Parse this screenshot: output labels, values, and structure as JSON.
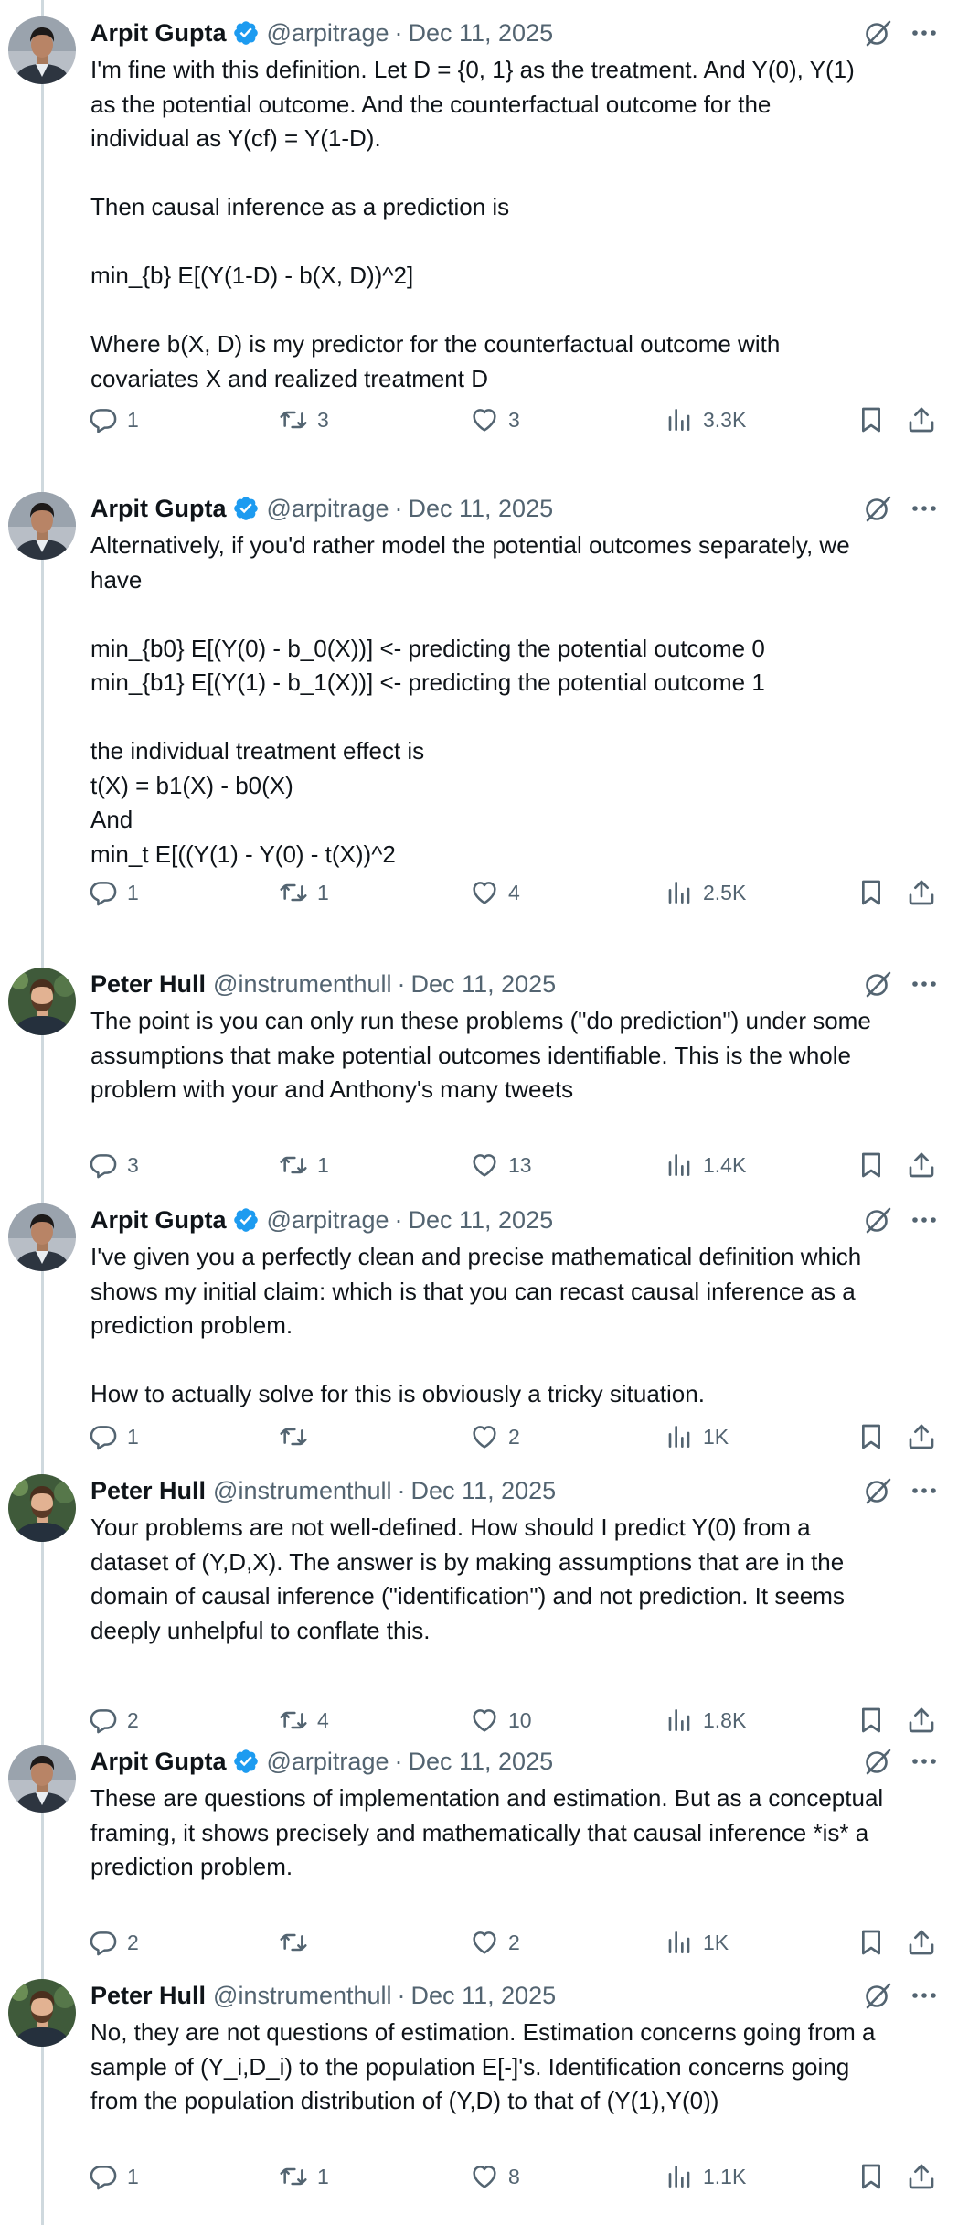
{
  "tweets": [
    {
      "author": "Arpit Gupta",
      "verified": true,
      "handle": "@arpitrage",
      "date": "Dec 11, 2025",
      "text": "I'm fine with this definition. Let D = {0, 1} as the treatment. And Y(0), Y(1)\nas the potential outcome. And the counterfactual outcome for the\nindividual as Y(cf) = Y(1-D).\n\nThen causal inference as a prediction is\n\nmin_{b} E[(Y(1-D) - b(X, D))^2]\n\nWhere b(X, D) is my predictor for the counterfactual outcome with\ncovariates X and realized treatment D",
      "replies": "1",
      "reposts": "3",
      "likes": "3",
      "views": "3.3K"
    },
    {
      "author": "Arpit Gupta",
      "verified": true,
      "handle": "@arpitrage",
      "date": "Dec 11, 2025",
      "text": "Alternatively, if you'd rather model the potential outcomes separately, we\nhave\n\nmin_{b0} E[(Y(0) - b_0(X))] <- predicting the potential outcome 0\nmin_{b1} E[(Y(1) - b_1(X))] <- predicting the potential outcome 1\n\nthe individual treatment effect is\nt(X) = b1(X) - b0(X)\nAnd\nmin_t E[((Y(1) - Y(0) - t(X))^2",
      "replies": "1",
      "reposts": "1",
      "likes": "4",
      "views": "2.5K"
    },
    {
      "author": "Peter Hull",
      "verified": false,
      "handle": "@instrumenthull",
      "date": "Dec 11, 2025",
      "text": "The point is you can only run these problems (\"do prediction\") under some\nassumptions that make potential outcomes identifiable. This is the whole\nproblem with your and Anthony's many tweets",
      "replies": "3",
      "reposts": "1",
      "likes": "13",
      "views": "1.4K"
    },
    {
      "author": "Arpit Gupta",
      "verified": true,
      "handle": "@arpitrage",
      "date": "Dec 11, 2025",
      "text": "I've given you a perfectly clean and precise mathematical definition which\nshows my initial claim: which is that you can recast causal inference as a\nprediction problem.\n\nHow to actually solve for this is obviously a tricky situation.",
      "replies": "1",
      "reposts": "",
      "likes": "2",
      "views": "1K"
    },
    {
      "author": "Peter Hull",
      "verified": false,
      "handle": "@instrumenthull",
      "date": "Dec 11, 2025",
      "text": "Your problems are not well-defined. How should I predict Y(0) from a\ndataset of (Y,D,X). The answer is by making assumptions that are in the\ndomain of causal inference (\"identification\") and not prediction. It seems\ndeeply unhelpful to conflate this.",
      "replies": "2",
      "reposts": "4",
      "likes": "10",
      "views": "1.8K"
    },
    {
      "author": "Arpit Gupta",
      "verified": true,
      "handle": "@arpitrage",
      "date": "Dec 11, 2025",
      "text": "These are questions of implementation and estimation. But as a conceptual\nframing, it shows precisely and mathematically that causal inference *is* a\nprediction problem.",
      "replies": "2",
      "reposts": "",
      "likes": "2",
      "views": "1K"
    },
    {
      "author": "Peter Hull",
      "verified": false,
      "handle": "@instrumenthull",
      "date": "Dec 11, 2025",
      "text": "No, they are not questions of estimation. Estimation concerns going from a\nsample of (Y_i,D_i) to the population E[-]'s. Identification concerns going\nfrom the population distribution of (Y,D) to that of (Y(1),Y(0))",
      "replies": "1",
      "reposts": "1",
      "likes": "8",
      "views": "1.1K"
    }
  ],
  "separator": "·",
  "colors": {
    "text": "#0f1419",
    "muted": "#536471",
    "verified": "#1d9bf0",
    "thread_line": "#cfd9de"
  },
  "icons": [
    "verified-badge-icon",
    "grok-icon",
    "more-icon",
    "reply-icon",
    "repost-icon",
    "like-icon",
    "views-icon",
    "bookmark-icon",
    "share-icon"
  ]
}
